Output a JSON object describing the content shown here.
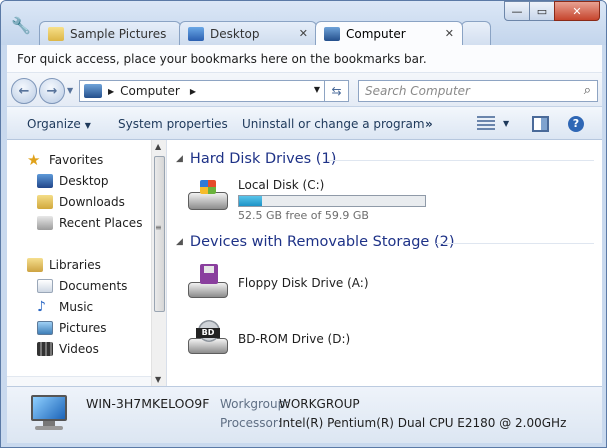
{
  "tabs": [
    {
      "label": "Sample Pictures",
      "icon": "folder-icon",
      "active": false
    },
    {
      "label": "Desktop",
      "icon": "desktop-icon",
      "active": false
    },
    {
      "label": "Computer",
      "icon": "computer-icon",
      "active": true
    }
  ],
  "window_buttons": {
    "minimize": "—",
    "maximize": "▭",
    "close": "✕"
  },
  "bookmarks_bar": {
    "text": "For quick access, place your bookmarks here on the bookmarks bar."
  },
  "address": {
    "crumb": "Computer"
  },
  "search": {
    "placeholder": "Search Computer"
  },
  "commands": {
    "organize": "Organize",
    "system_properties": "System properties",
    "uninstall": "Uninstall or change a program",
    "overflow": "»"
  },
  "nav": {
    "favorites": {
      "label": "Favorites",
      "items": [
        "Desktop",
        "Downloads",
        "Recent Places"
      ]
    },
    "libraries": {
      "label": "Libraries",
      "items": [
        "Documents",
        "Music",
        "Pictures",
        "Videos"
      ]
    }
  },
  "groups": {
    "hard_disks": {
      "title": "Hard Disk Drives (1)",
      "drives": [
        {
          "name": "Local Disk (C:)",
          "free_text": "52.5 GB free of 59.9 GB",
          "used_fraction": 0.124
        }
      ]
    },
    "removable": {
      "title": "Devices with Removable Storage (2)",
      "drives": [
        {
          "name": "Floppy Disk Drive (A:)"
        },
        {
          "name": "BD-ROM Drive (D:)"
        }
      ]
    }
  },
  "details": {
    "computer_name": "WIN-3H7MKELOO9F",
    "workgroup_label": "Workgroup:",
    "workgroup_value": "WORKGROUP",
    "processor_label": "Processor:",
    "processor_value": "Intel(R) Pentium(R) Dual  CPU  E2180  @ 2.00GHz"
  },
  "colors": {
    "accent_blue": "#1e3287",
    "capacity_fill": "#1d93c6",
    "close_button": "#c6452d"
  }
}
